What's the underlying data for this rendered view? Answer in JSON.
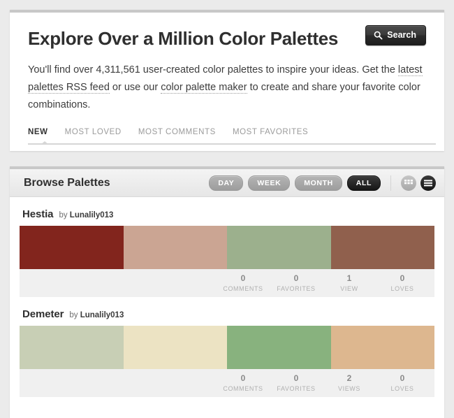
{
  "hero": {
    "title": "Explore Over a Million Color Palettes",
    "search_label": "Search",
    "search_icon": "search-icon",
    "paragraph": {
      "part1": "You'll find over 4,311,561 user-created color palettes to inspire your ideas. Get the ",
      "link1": "latest palettes RSS feed",
      "part2": " or use our ",
      "link2": "color palette maker",
      "part3": " to create and share your favorite color combinations."
    },
    "tabs": [
      {
        "label": "NEW",
        "active": true
      },
      {
        "label": "MOST LOVED",
        "active": false
      },
      {
        "label": "MOST COMMENTS",
        "active": false
      },
      {
        "label": "MOST FAVORITES",
        "active": false
      }
    ]
  },
  "browse": {
    "title": "Browse Palettes",
    "ranges": [
      {
        "label": "DAY",
        "active": false
      },
      {
        "label": "WEEK",
        "active": false
      },
      {
        "label": "MONTH",
        "active": false
      },
      {
        "label": "ALL",
        "active": true
      }
    ],
    "views": [
      {
        "icon": "grid-view-icon",
        "active": false
      },
      {
        "icon": "list-view-icon",
        "active": true
      }
    ],
    "palettes": [
      {
        "name": "Hestia",
        "by_prefix": "by",
        "author": "Lunalily013",
        "colors": [
          "#82251d",
          "#cba593",
          "#9cb08d",
          "#90604d"
        ],
        "stats": [
          {
            "num": "0",
            "label": "COMMENTS"
          },
          {
            "num": "0",
            "label": "FAVORITES"
          },
          {
            "num": "1",
            "label": "VIEW"
          },
          {
            "num": "0",
            "label": "LOVES"
          }
        ]
      },
      {
        "name": "Demeter",
        "by_prefix": "by",
        "author": "Lunalily013",
        "colors": [
          "#c8cfb5",
          "#ece3c3",
          "#88b27e",
          "#ddb78f"
        ],
        "stats": [
          {
            "num": "0",
            "label": "COMMENTS"
          },
          {
            "num": "0",
            "label": "FAVORITES"
          },
          {
            "num": "2",
            "label": "VIEWS"
          },
          {
            "num": "0",
            "label": "LOVES"
          }
        ]
      }
    ]
  }
}
